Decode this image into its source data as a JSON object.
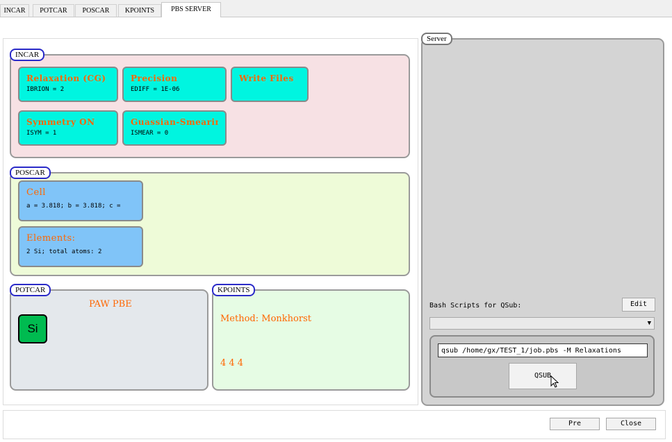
{
  "tabs": [
    "INCAR",
    "POTCAR",
    "POSCAR",
    "KPOINTS",
    "PBS SERVER"
  ],
  "active_tab": "PBS SERVER",
  "incar": {
    "title": "INCAR",
    "cards": [
      {
        "title": "Relaxation (CG)",
        "sub": "IBRION = 2"
      },
      {
        "title": "Precision",
        "sub": "EDIFF = 1E-06"
      },
      {
        "title": "Write Files",
        "sub": ""
      },
      {
        "title": "Symmetry ON",
        "sub": "ISYM = 1"
      },
      {
        "title": "Guassian-Smearin",
        "sub": "ISMEAR = 0"
      }
    ]
  },
  "poscar": {
    "title": "POSCAR",
    "cards": [
      {
        "title": "Cell",
        "sub": "a = 3.818; b = 3.818; c ="
      },
      {
        "title": "Elements:",
        "sub": "2 Si; total atoms: 2"
      }
    ]
  },
  "potcar": {
    "title": "POTCAR",
    "functional": "PAW PBE",
    "element": "Si"
  },
  "kpoints": {
    "title": "KPOINTS",
    "method": "Method: Monkhorst",
    "grid": "4 4 4"
  },
  "server": {
    "title": "Server",
    "bash_label": "Bash Scripts for QSub:",
    "edit_label": "Edit",
    "selected_script": "",
    "command": "qsub /home/gx/TEST_1/job.pbs -M Relaxations",
    "qsub_label": "QSUB"
  },
  "footer": {
    "pre_label": "Pre",
    "close_label": "Close"
  },
  "colors": {
    "incar_bg": "#f7e1e4",
    "poscar_bg": "#eefbd8",
    "potcar_bg": "#e4e8ec",
    "kpoints_bg": "#e6fce4",
    "card_cyan": "#00f5e0",
    "card_blue": "#80c4f8",
    "accent_text": "#ff6600",
    "title_border": "#2a2ac8"
  }
}
